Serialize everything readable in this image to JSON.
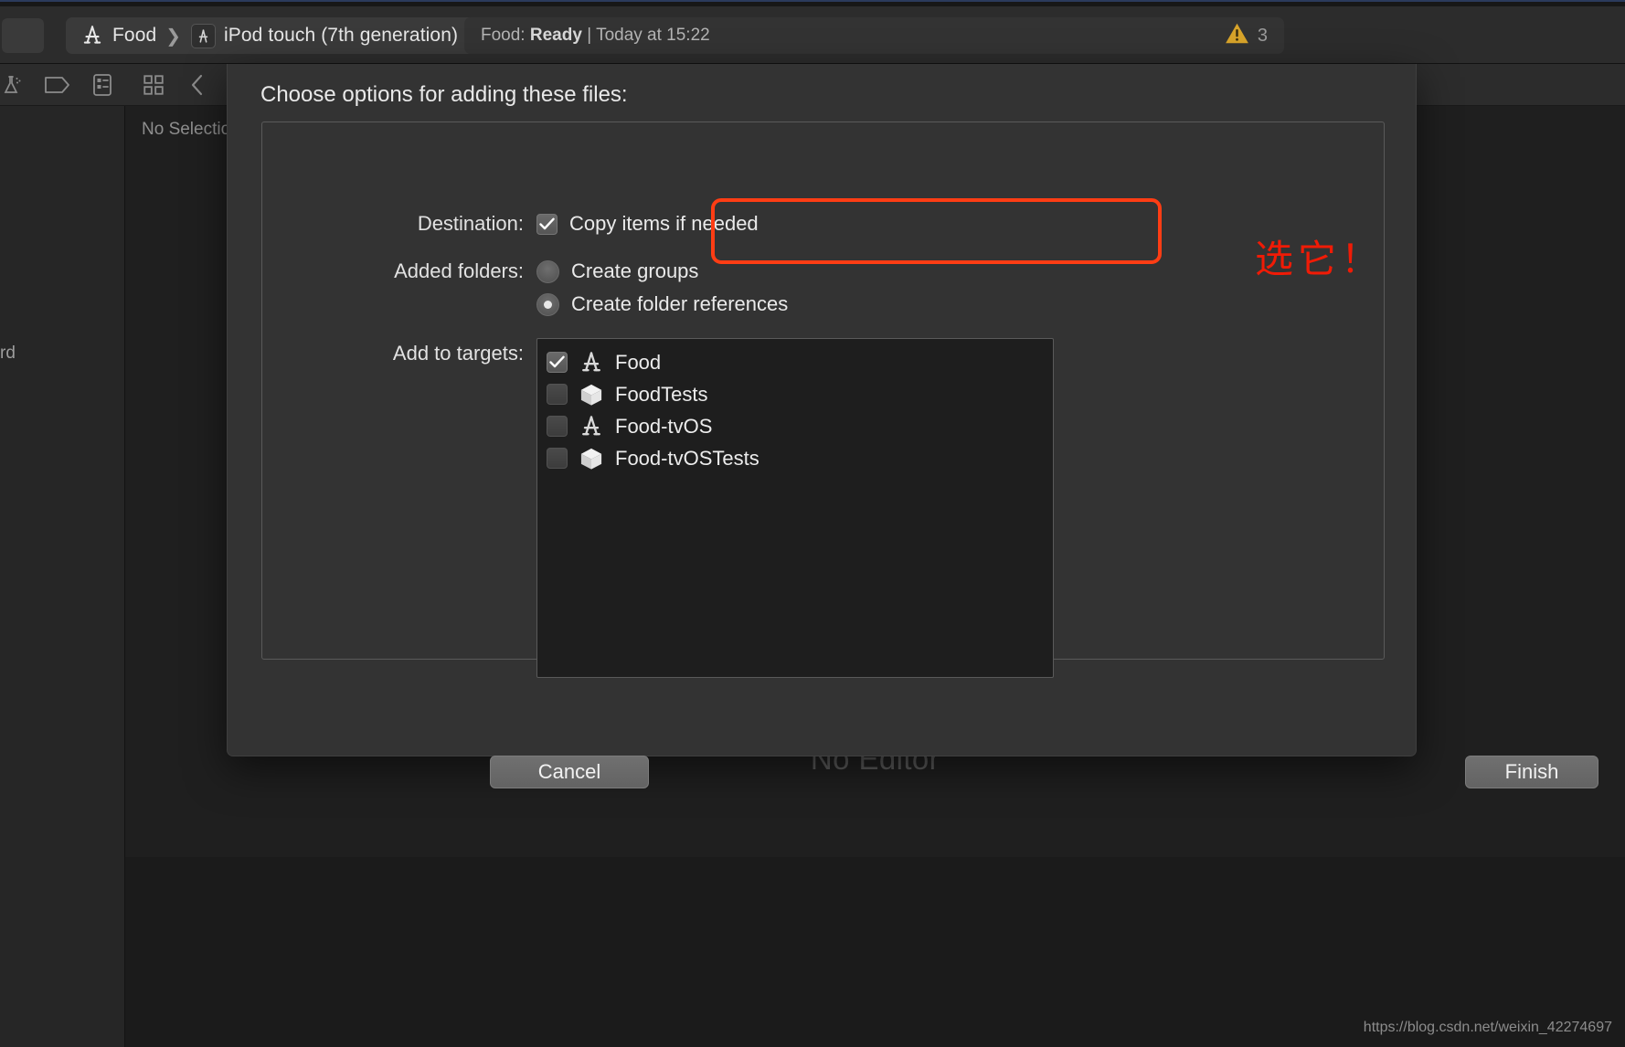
{
  "toolbar": {
    "breadcrumb": {
      "scheme_icon": "xcode-app-icon",
      "scheme": "Food",
      "separator": "❯",
      "device_icon": "ipod-touch-icon",
      "device": "iPod touch (7th generation)"
    },
    "status": {
      "prefix": "Food:",
      "state": "Ready",
      "divider": "|",
      "timestamp": "Today at 15:22"
    },
    "warning": {
      "icon": "warning-triangle-icon",
      "count": "3"
    }
  },
  "navigator": {
    "icons": [
      "test-navigator-icon",
      "issue-navigator-icon",
      "report-navigator-icon"
    ],
    "empty_label": "rd"
  },
  "editor": {
    "icons": [
      "related-items-icon",
      "back-chevron-icon",
      "forward-chevron-icon"
    ],
    "jump_bar_label": "No Selection",
    "placeholder": "No Editor"
  },
  "dialog": {
    "title": "Choose options for adding these files:",
    "destination": {
      "label": "Destination:",
      "checkbox_label": "Copy items if needed",
      "checked": true
    },
    "added_folders": {
      "label": "Added folders:",
      "options": [
        {
          "label": "Create groups",
          "selected": false
        },
        {
          "label": "Create folder references",
          "selected": true
        }
      ]
    },
    "add_to_targets": {
      "label": "Add to targets:",
      "items": [
        {
          "name": "Food",
          "icon": "xcode-app-target-icon",
          "checked": true
        },
        {
          "name": "FoodTests",
          "icon": "xcode-test-bundle-icon",
          "checked": false
        },
        {
          "name": "Food-tvOS",
          "icon": "xcode-app-target-icon",
          "checked": false
        },
        {
          "name": "Food-tvOSTests",
          "icon": "xcode-test-bundle-icon",
          "checked": false
        }
      ]
    },
    "buttons": {
      "cancel": "Cancel",
      "finish": "Finish"
    }
  },
  "annotation": {
    "text": "选它！",
    "color": "#f01b06",
    "highlight_color": "#ff3d14"
  },
  "watermark": "https://blog.csdn.net/weixin_42274697"
}
